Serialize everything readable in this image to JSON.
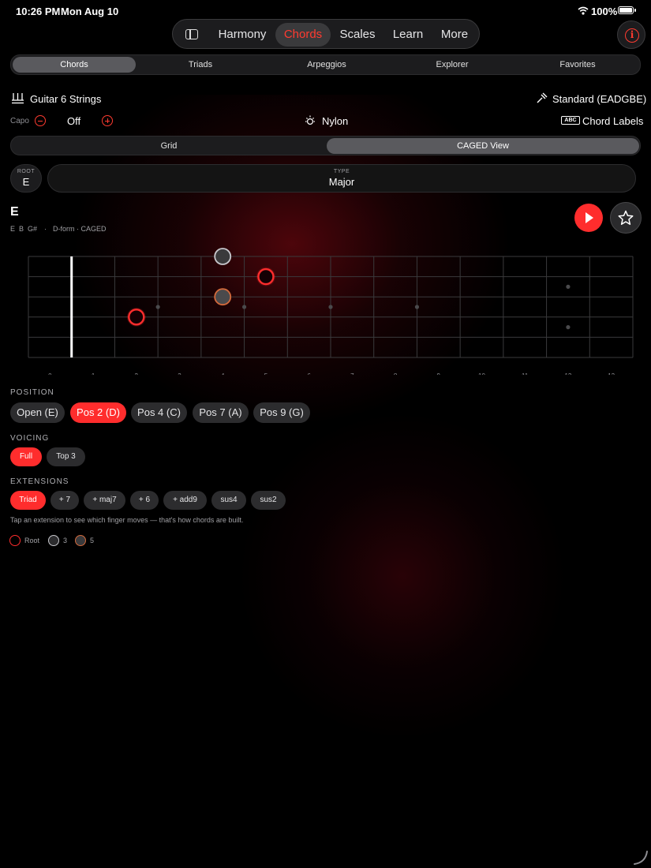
{
  "status": {
    "time": "10:26 PM",
    "date": "Mon Aug 10",
    "battery": "100%"
  },
  "nav": {
    "items": [
      "Harmony",
      "Chords",
      "Scales",
      "Learn",
      "More"
    ],
    "active": "Chords"
  },
  "tabs": {
    "items": [
      "Chords",
      "Triads",
      "Arpeggios",
      "Explorer",
      "Favorites"
    ],
    "active": "Chords"
  },
  "instrument": {
    "name": "Guitar 6 Strings",
    "tuning": "Standard (EADGBE)"
  },
  "capo": {
    "label": "Capo",
    "value": "Off"
  },
  "sound": {
    "name": "Nylon"
  },
  "labels": {
    "badge": "ABC",
    "text": "Chord Labels"
  },
  "view": {
    "items": [
      "Grid",
      "CAGED View"
    ],
    "active": "CAGED View"
  },
  "root": {
    "label": "ROOT",
    "value": "E"
  },
  "type": {
    "label": "TYPE",
    "value": "Major"
  },
  "chord": {
    "name": "E",
    "notes": "E  B  G#",
    "separator": "·",
    "form": "D-form · CAGED"
  },
  "fretboard": {
    "fret_numbers": [
      "0",
      "1",
      "2",
      "3",
      "4",
      "5",
      "6",
      "7",
      "8",
      "9",
      "10",
      "11",
      "12",
      "13"
    ],
    "notes": [
      {
        "string": 6,
        "fret": 4,
        "role": "3"
      },
      {
        "string": 5,
        "fret": 5,
        "role": "root"
      },
      {
        "string": 4,
        "fret": 4,
        "role": "5"
      },
      {
        "string": 3,
        "fret": 2,
        "role": "root"
      }
    ]
  },
  "position": {
    "label": "POSITION",
    "items": [
      "Open (E)",
      "Pos 2 (D)",
      "Pos 4 (C)",
      "Pos 7 (A)",
      "Pos 9 (G)"
    ],
    "active": "Pos 2 (D)"
  },
  "voicing": {
    "label": "VOICING",
    "items": [
      "Full",
      "Top 3"
    ],
    "active": "Full"
  },
  "extensions": {
    "label": "EXTENSIONS",
    "items": [
      "Triad",
      "+ 7",
      "+ maj7",
      "+ 6",
      "+ add9",
      "sus4",
      "sus2"
    ],
    "active": "Triad",
    "hint": "Tap an extension to see which finger moves — that's how chords are built."
  },
  "legend": {
    "root": "Root",
    "third": "3",
    "fifth": "5"
  },
  "colors": {
    "accent": "#ff3b30",
    "root": "#ff2d2d",
    "third": "#8e8e93",
    "fifth": "#d36a3c"
  }
}
